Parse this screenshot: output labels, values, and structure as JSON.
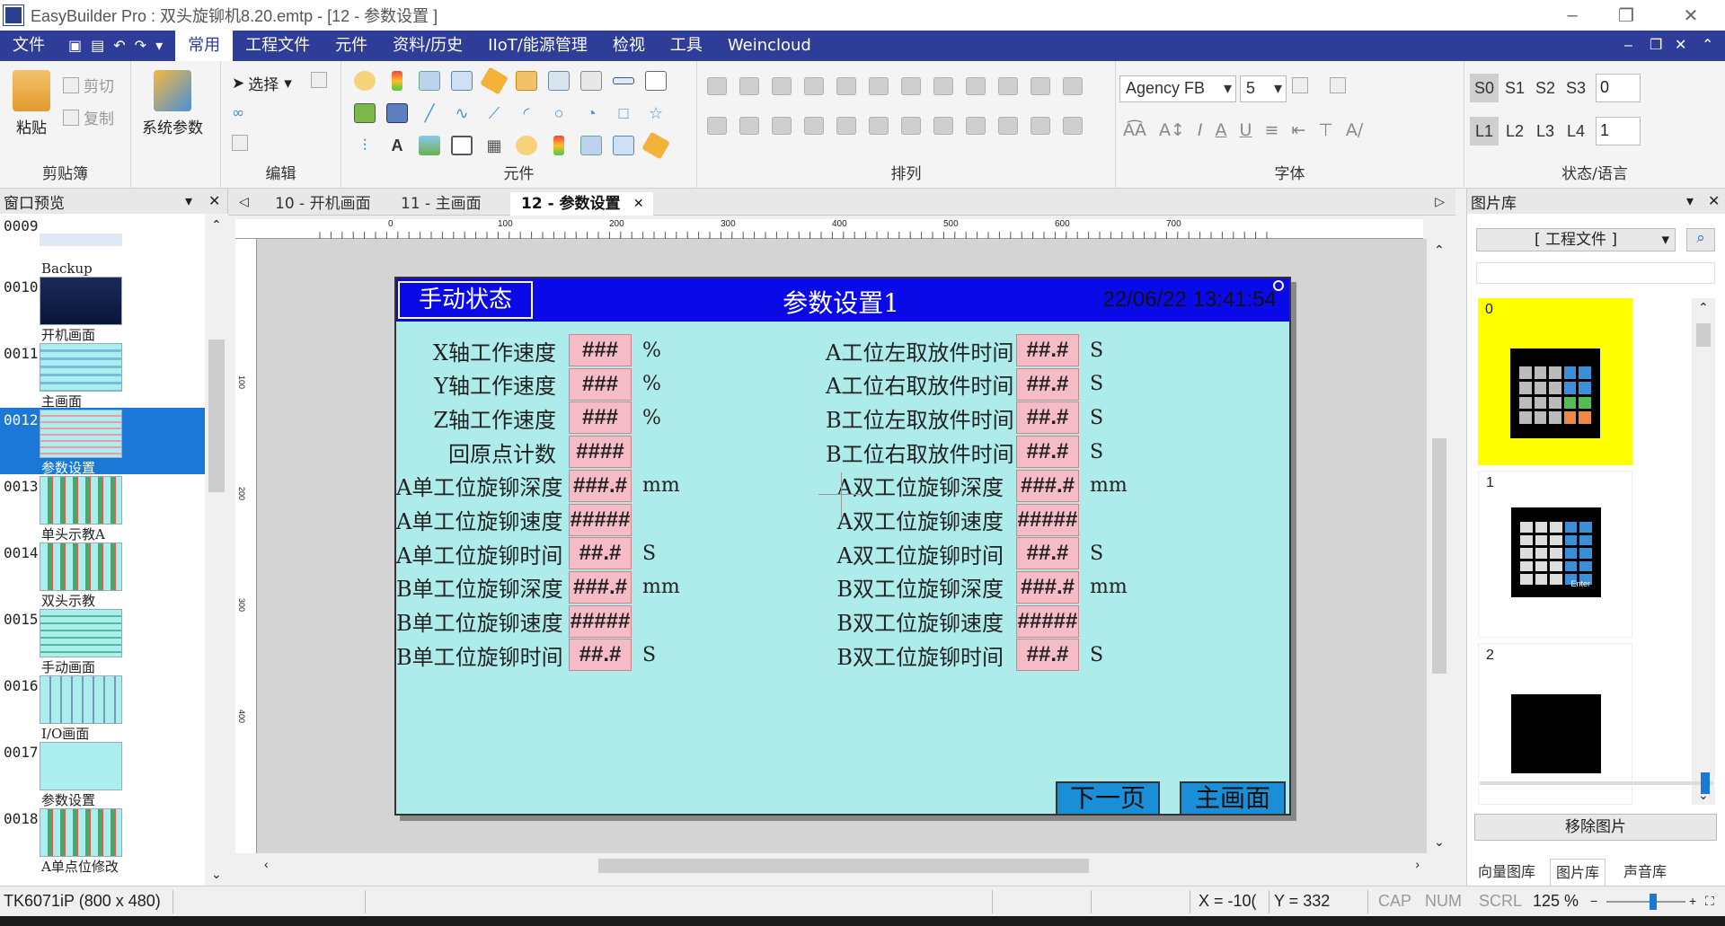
{
  "window": {
    "title": "EasyBuilder Pro : 双头旋铆机8.20.emtp - [12 - 参数设置 ]"
  },
  "menu": {
    "items": [
      "文件",
      "常用",
      "工程文件",
      "元件",
      "资料/历史",
      "IIoT/能源管理",
      "检视",
      "工具",
      "Weincloud"
    ],
    "active": "常用"
  },
  "ribbon": {
    "clipboard": {
      "label": "剪贴簿",
      "paste": "粘贴",
      "cut": "剪切",
      "copy": "复制"
    },
    "sysparam": "系统参数",
    "edit": {
      "label": "编辑",
      "select": "选择"
    },
    "objects": {
      "label": "元件"
    },
    "arrange": {
      "label": "排列"
    },
    "font": {
      "label": "字体",
      "family": "Agency FB",
      "size": "5"
    },
    "state": {
      "label": "状态/语言",
      "states": [
        "S0",
        "S1",
        "S2",
        "S3"
      ],
      "state_value": "0",
      "langs": [
        "L1",
        "L2",
        "L3",
        "L4"
      ],
      "lang_value": "1"
    }
  },
  "left_panel": {
    "title": "窗口预览",
    "windows": [
      {
        "num": "0009",
        "name": "Backup"
      },
      {
        "num": "0010",
        "name": "开机画面"
      },
      {
        "num": "0011",
        "name": "主画面"
      },
      {
        "num": "0012",
        "name": "参数设置",
        "selected": true
      },
      {
        "num": "0013",
        "name": "单头示教A"
      },
      {
        "num": "0014",
        "name": "双头示教"
      },
      {
        "num": "0015",
        "name": "手动画面"
      },
      {
        "num": "0016",
        "name": "I/O画面"
      },
      {
        "num": "0017",
        "name": "参数设置"
      },
      {
        "num": "0018",
        "name": "A单点位修改"
      }
    ]
  },
  "tabs": [
    {
      "label": "10 - 开机画面"
    },
    {
      "label": "11 - 主画面"
    },
    {
      "label": "12 - 参数设置",
      "active": true
    }
  ],
  "ruler": {
    "marks": [
      "0",
      "100",
      "200",
      "300",
      "400",
      "500",
      "600",
      "700"
    ],
    "vmarks": [
      "100",
      "200",
      "300",
      "400"
    ]
  },
  "hmi": {
    "mode": "手动状态",
    "title": "参数设置1",
    "datetime": "22/06/22 13:41:54",
    "left_params": [
      {
        "label": "X轴工作速度",
        "value": "###",
        "unit": "%"
      },
      {
        "label": "Y轴工作速度",
        "value": "###",
        "unit": "%"
      },
      {
        "label": "Z轴工作速度",
        "value": "###",
        "unit": "%"
      },
      {
        "label": "回原点计数",
        "value": "####",
        "unit": ""
      },
      {
        "label": "A单工位旋铆深度",
        "value": "###.#",
        "unit": "mm"
      },
      {
        "label": "A单工位旋铆速度",
        "value": "#####",
        "unit": ""
      },
      {
        "label": "A单工位旋铆时间",
        "value": "##.#",
        "unit": "S"
      },
      {
        "label": "B单工位旋铆深度",
        "value": "###.#",
        "unit": "mm"
      },
      {
        "label": "B单工位旋铆速度",
        "value": "#####",
        "unit": ""
      },
      {
        "label": "B单工位旋铆时间",
        "value": "##.#",
        "unit": "S"
      }
    ],
    "right_params": [
      {
        "label": "A工位左取放件时间",
        "value": "##.#",
        "unit": "S"
      },
      {
        "label": "A工位右取放件时间",
        "value": "##.#",
        "unit": "S"
      },
      {
        "label": "B工位左取放件时间",
        "value": "##.#",
        "unit": "S"
      },
      {
        "label": "B工位右取放件时间",
        "value": "##.#",
        "unit": "S"
      },
      {
        "label": "A双工位旋铆深度",
        "value": "###.#",
        "unit": "mm"
      },
      {
        "label": "A双工位旋铆速度",
        "value": "#####",
        "unit": ""
      },
      {
        "label": "A双工位旋铆时间",
        "value": "##.#",
        "unit": "S"
      },
      {
        "label": "B双工位旋铆深度",
        "value": "###.#",
        "unit": "mm"
      },
      {
        "label": "B双工位旋铆速度",
        "value": "#####",
        "unit": ""
      },
      {
        "label": "B双工位旋铆时间",
        "value": "##.#",
        "unit": "S"
      }
    ],
    "next_button": "下一页",
    "main_button": "主画面"
  },
  "right_panel": {
    "title": "图片库",
    "source": "[ 工程文件 ]",
    "pictures": [
      "0",
      "1",
      "2"
    ],
    "remove_button": "移除图片",
    "bottom_tabs": [
      "向量图库",
      "图片库",
      "声音库"
    ],
    "active_tab": "图片库",
    "keypad_enter": "Enter"
  },
  "status": {
    "device": "TK6071iP (800 x 480)",
    "x": "X = -10(",
    "y": "Y = 332",
    "cap": "CAP",
    "num": "NUM",
    "scrl": "SCRL",
    "zoom": "125 %"
  },
  "colors": {
    "menubar": "#2e3e98",
    "hmi_bg": "#aeecec",
    "hmi_header": "#0a0ae8",
    "field": "#f5bcc8",
    "nav_button": "#1a8fd8",
    "selected": "#1b78d6",
    "picture_selected": "#ffff00"
  }
}
